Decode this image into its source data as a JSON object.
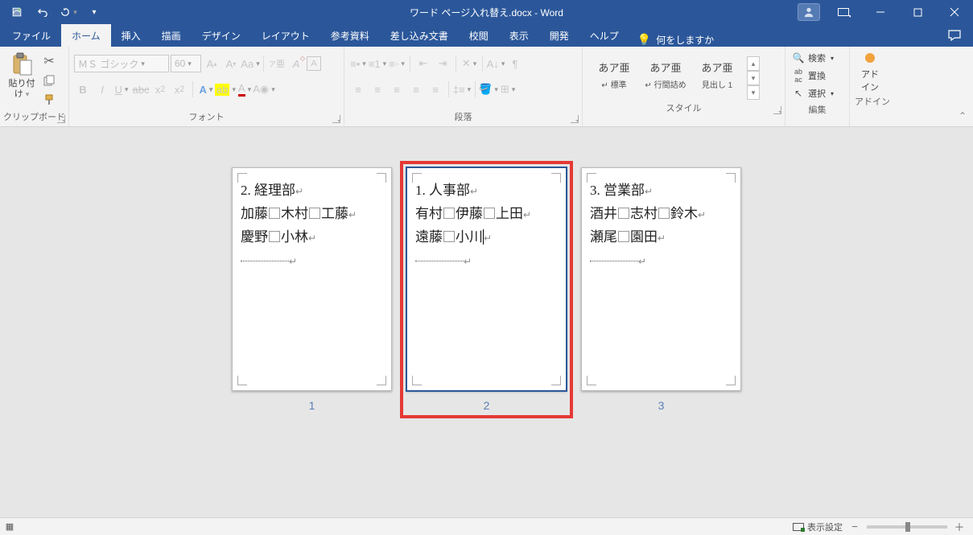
{
  "title": "ワード ページ入れ替え.docx - Word",
  "qat": {
    "save_aria": "save",
    "undo_aria": "undo",
    "redo_aria": "redo"
  },
  "tabs": [
    "ファイル",
    "ホーム",
    "挿入",
    "描画",
    "デザイン",
    "レイアウト",
    "参考資料",
    "差し込み文書",
    "校閲",
    "表示",
    "開発",
    "ヘルプ"
  ],
  "active_tab_index": 1,
  "tell_me": "何をしますか",
  "ribbon": {
    "clipboard": {
      "label": "クリップボード",
      "paste": "貼り付け"
    },
    "font": {
      "label": "フォント",
      "name": "ＭＳ ゴシック",
      "size": "60"
    },
    "paragraph": {
      "label": "段落"
    },
    "styles": {
      "label": "スタイル",
      "items": [
        {
          "sample": "あア亜",
          "name": "↵ 標準"
        },
        {
          "sample": "あア亜",
          "name": "↵ 行間詰め"
        },
        {
          "sample": "あア亜",
          "name": "見出し 1"
        }
      ]
    },
    "editing": {
      "label": "編集",
      "find": "検索",
      "replace": "置換",
      "select": "選択"
    },
    "addin": {
      "label": "アドイン",
      "btn": "アド\nイン"
    }
  },
  "pages": [
    {
      "num": "1",
      "title": "2. 経理部",
      "line2": [
        "加藤",
        "木村",
        "工藤"
      ],
      "line3": [
        "慶野",
        "小林"
      ],
      "selected": false
    },
    {
      "num": "2",
      "title": "1. 人事部",
      "line2": [
        "有村",
        "伊藤",
        "上田"
      ],
      "line3": [
        "遠藤",
        "小川"
      ],
      "selected": true,
      "cursor": true
    },
    {
      "num": "3",
      "title": "3. 営業部",
      "line2": [
        "酒井",
        "志村",
        "鈴木"
      ],
      "line3": [
        "瀬尾",
        "園田"
      ],
      "selected": false
    }
  ],
  "highlight_page_index": 1,
  "statusbar": {
    "display_settings": "表示設定"
  }
}
